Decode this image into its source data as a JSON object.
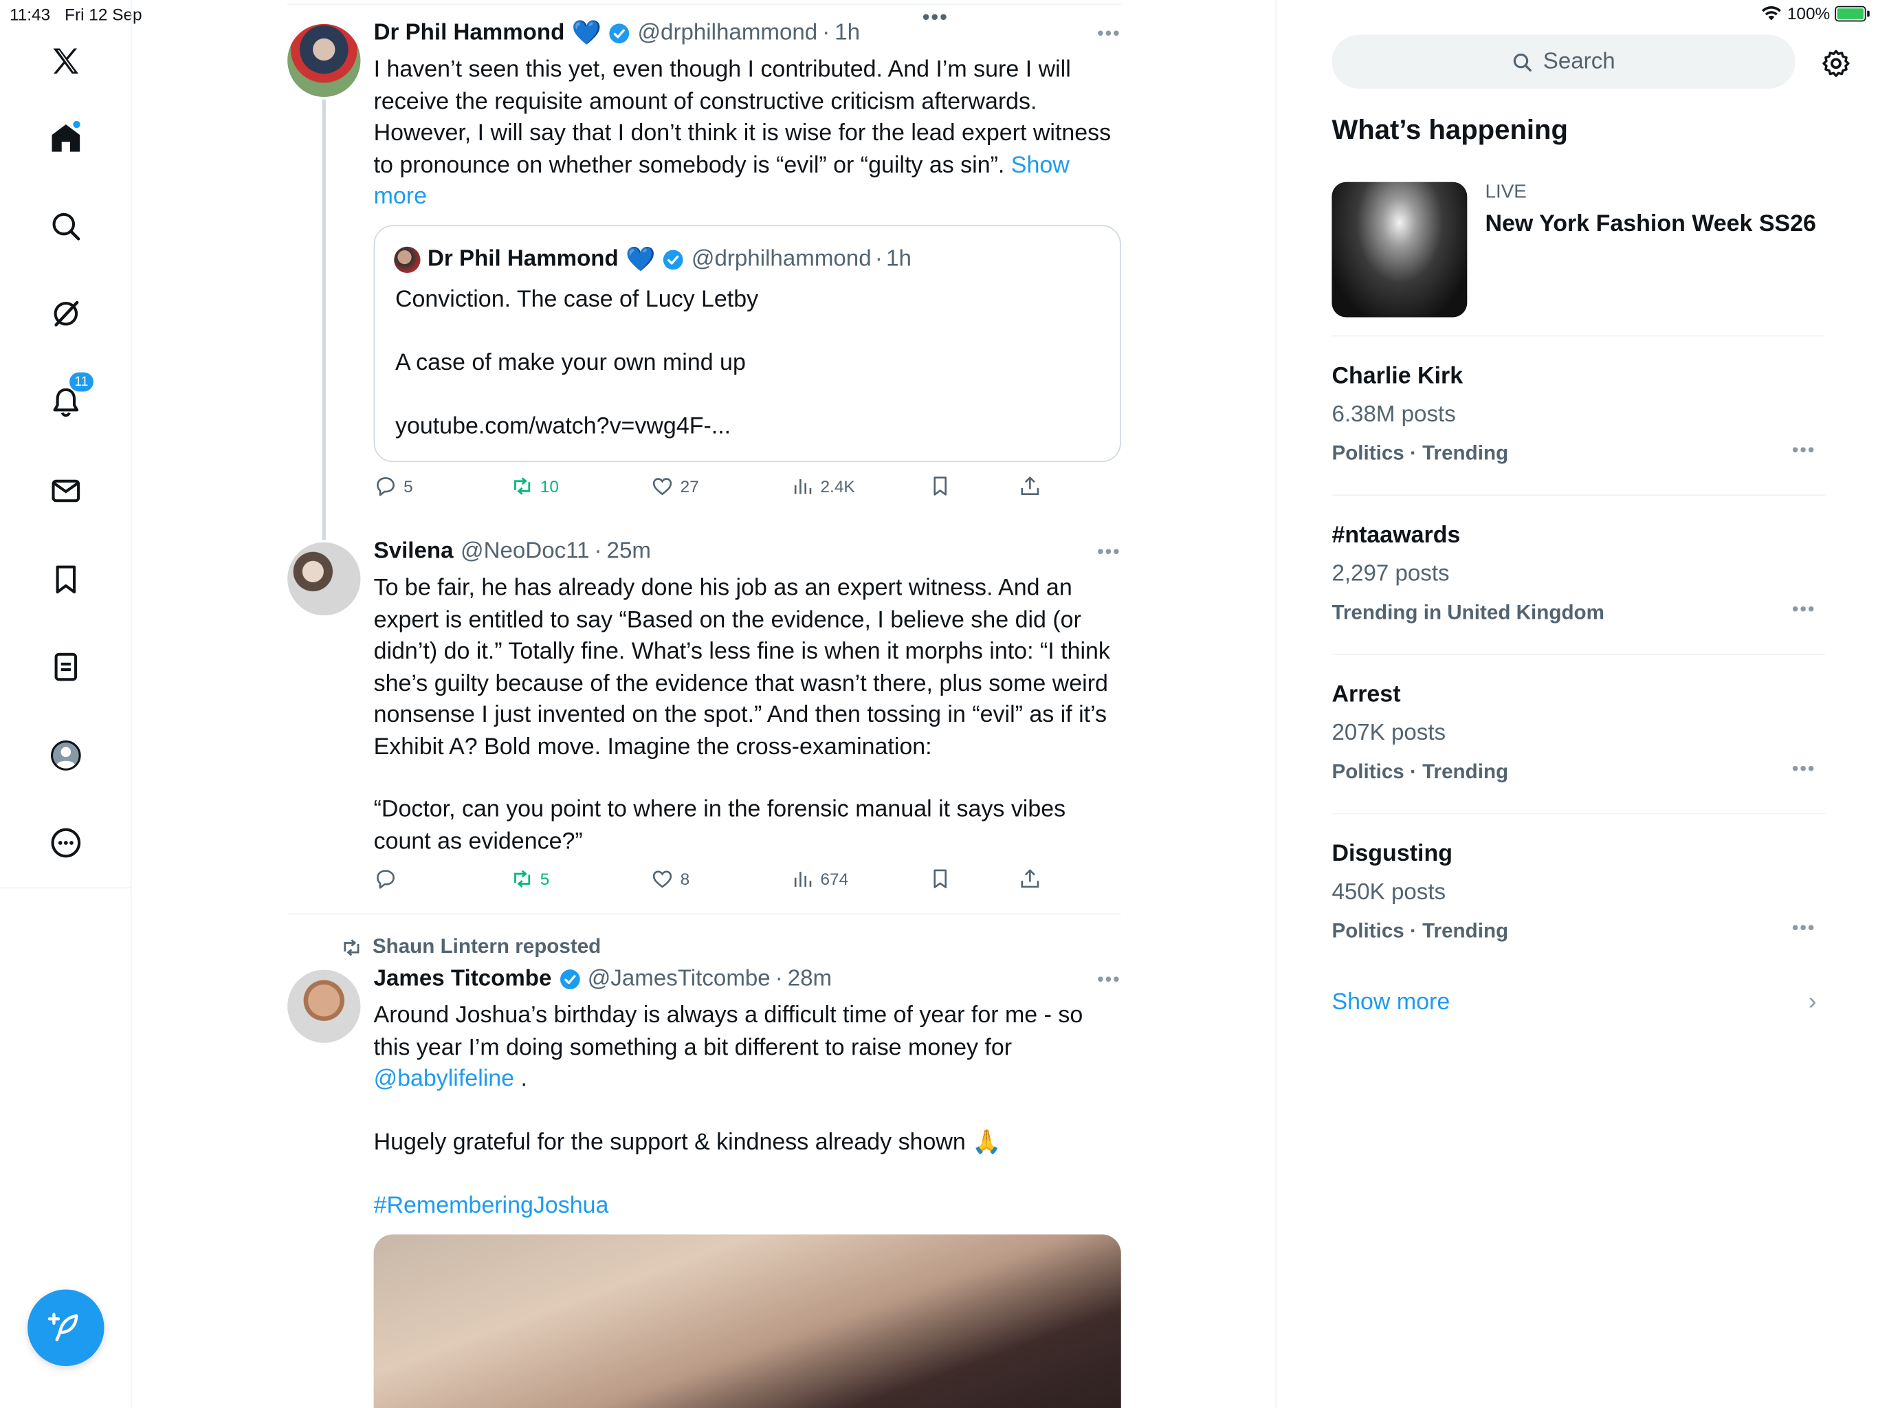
{
  "status_bar": {
    "time": "11:43",
    "date": "Fri 12 Sep",
    "battery": "100%"
  },
  "nav": {
    "items": [
      "x-logo",
      "home",
      "explore",
      "grok",
      "notifications",
      "messages",
      "bookmarks",
      "lists",
      "profile",
      "more"
    ],
    "notifications_badge": "11"
  },
  "timeline": {
    "top_menu": "•••",
    "tweet1": {
      "name": "Dr Phil Hammond",
      "heart": "💙",
      "handle": "@drphilhammond",
      "sep": "·",
      "time": "1h",
      "text": "I haven’t seen this yet, even though I contributed. And I’m sure I will receive the requisite amount of constructive criticism afterwards. However, I will say that I don’t think it is wise for the lead expert witness to pronounce on whether somebody is “evil” or “guilty as sin”. ",
      "show_more": "Show more",
      "quote": {
        "name": "Dr Phil Hammond",
        "heart": "💙",
        "handle": "@drphilhammond",
        "sep": "·",
        "time": "1h",
        "text": "Conviction. The case of Lucy Letby\n\nA case of make your own mind up\n\nyoutube.com/watch?v=vwg4F-..."
      },
      "stats": {
        "replies": "5",
        "reposts": "10",
        "likes": "27",
        "views": "2.4K"
      }
    },
    "tweet2": {
      "name": "Svilena",
      "handle": "@NeoDoc11",
      "sep": "·",
      "time": "25m",
      "text": "To be fair, he has already done his job as an expert witness. And an expert is entitled to say “Based on the evidence, I believe she did (or didn’t) do it.” Totally fine. What’s less fine is when it morphs into: “I think she’s guilty because of the evidence that wasn’t there, plus some weird nonsense I just invented on the spot.” And then tossing in “evil” as if it’s Exhibit A? Bold move. Imagine the cross-examination:",
      "text2": "“Doctor, can you point to where in the forensic manual it says vibes count as evidence?”",
      "stats": {
        "replies": "",
        "reposts": "5",
        "likes": "8",
        "views": "674"
      }
    },
    "tweet3": {
      "repost_label": "Shaun Lintern reposted",
      "name": "James Titcombe",
      "handle": "@JamesTitcombe",
      "sep": "·",
      "time": "28m",
      "text_a": "Around Joshua’s birthday is always a difficult time of year for me - so this year I’m doing something a bit different to raise money for ",
      "mention": "@babylifeline",
      "text_b": " .",
      "text_c": "Hugely grateful for the support & kindness already shown 🙏",
      "hashtag": "#RememberingJoshua"
    }
  },
  "sidebar": {
    "search_placeholder": "Search",
    "whats_happening": "What’s happening",
    "featured": {
      "live": "LIVE",
      "title": "New York Fashion Week SS26"
    },
    "trends": [
      {
        "name": "Charlie Kirk",
        "posts": "6.38M posts",
        "context": "Politics · Trending"
      },
      {
        "name": "#ntaawards",
        "posts": "2,297 posts",
        "context": "Trending in United Kingdom"
      },
      {
        "name": "Arrest",
        "posts": "207K posts",
        "context": "Politics · Trending"
      },
      {
        "name": "Disgusting",
        "posts": "450K posts",
        "context": "Politics · Trending"
      }
    ],
    "trend_more": "•••",
    "show_more": "Show more",
    "chevron": "›"
  },
  "colors": {
    "accent": "#1d9bf0",
    "repost_green": "#00ba7c",
    "muted": "#536471",
    "text": "#0f1419"
  }
}
